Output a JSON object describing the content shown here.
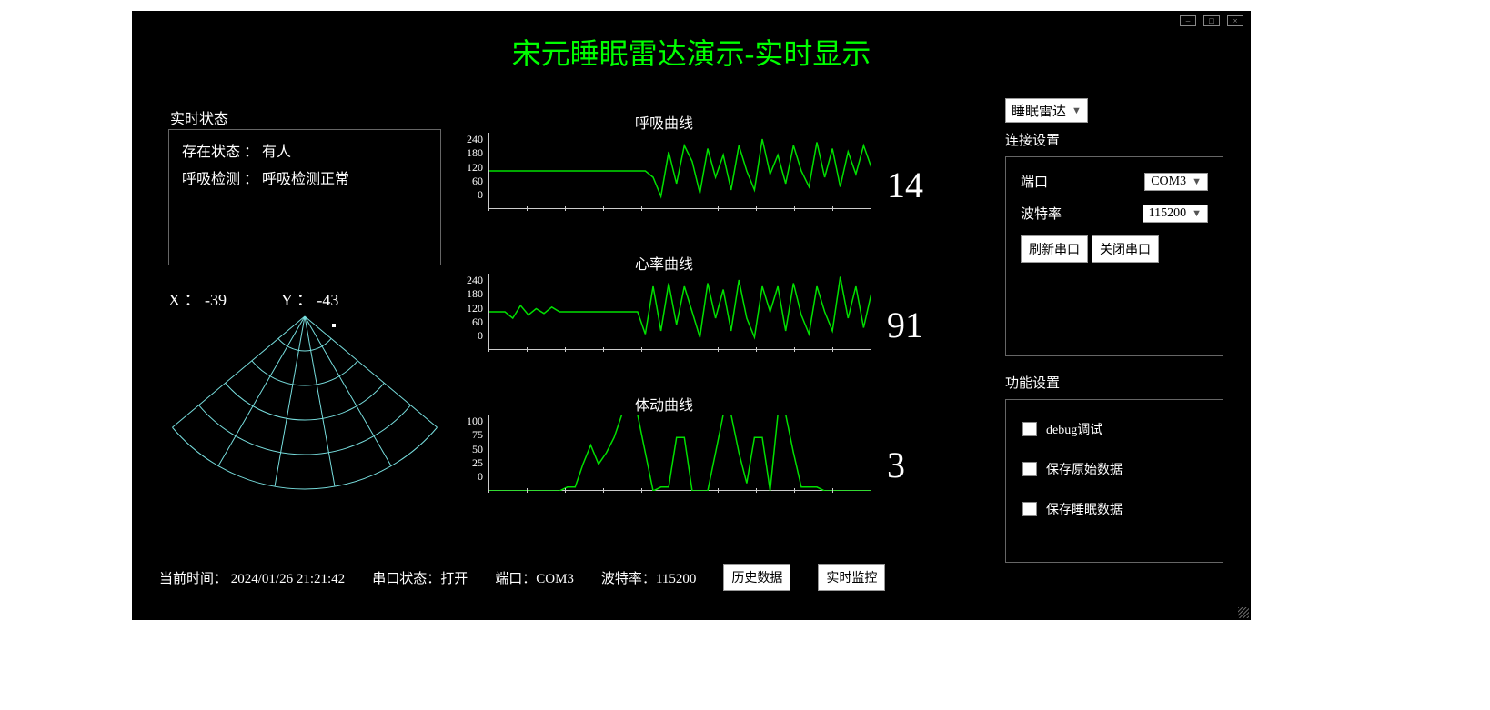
{
  "title": "宋元睡眠雷达演示-实时显示",
  "status_panel": {
    "label": "实时状态",
    "row1_label": "存在状态 ：",
    "row1_value": "有人",
    "row2_label": "呼吸检测 ：",
    "row2_value": "呼吸检测正常"
  },
  "xy": {
    "x_label": "X ：",
    "x_value": "-39",
    "y_label": "Y ：",
    "y_value": "-43"
  },
  "charts": {
    "breath": {
      "title": "呼吸曲线",
      "ymax": 240,
      "value": "14"
    },
    "heart": {
      "title": "心率曲线",
      "ymax": 240,
      "value": "91"
    },
    "motion": {
      "title": "体动曲线",
      "ymax": 100,
      "value": "3"
    }
  },
  "chart_data": [
    {
      "type": "line",
      "title": "呼吸曲线",
      "xlabel": "",
      "ylabel": "",
      "ylim": [
        0,
        240
      ],
      "yticks": [
        0,
        60,
        120,
        180,
        240
      ],
      "values": [
        120,
        120,
        120,
        120,
        120,
        120,
        120,
        120,
        120,
        120,
        120,
        120,
        120,
        120,
        120,
        120,
        120,
        120,
        120,
        120,
        120,
        100,
        40,
        180,
        80,
        200,
        150,
        50,
        190,
        100,
        170,
        60,
        200,
        120,
        60,
        220,
        110,
        170,
        80,
        200,
        120,
        70,
        210,
        100,
        190,
        70,
        180,
        110,
        200,
        130
      ]
    },
    {
      "type": "line",
      "title": "心率曲线",
      "xlabel": "",
      "ylabel": "",
      "ylim": [
        0,
        240
      ],
      "yticks": [
        0,
        60,
        120,
        180,
        240
      ],
      "values": [
        120,
        120,
        120,
        100,
        140,
        110,
        130,
        115,
        135,
        120,
        120,
        120,
        120,
        120,
        120,
        120,
        120,
        120,
        120,
        120,
        50,
        200,
        60,
        210,
        80,
        200,
        120,
        40,
        210,
        100,
        190,
        60,
        220,
        100,
        40,
        200,
        120,
        200,
        60,
        210,
        110,
        50,
        200,
        120,
        60,
        230,
        100,
        200,
        70,
        180
      ]
    },
    {
      "type": "line",
      "title": "体动曲线",
      "xlabel": "",
      "ylabel": "",
      "ylim": [
        0,
        100
      ],
      "yticks": [
        0,
        25,
        50,
        75,
        100
      ],
      "values": [
        0,
        0,
        0,
        0,
        0,
        0,
        0,
        0,
        0,
        0,
        5,
        5,
        35,
        60,
        35,
        50,
        70,
        100,
        100,
        100,
        50,
        0,
        5,
        5,
        70,
        70,
        0,
        0,
        0,
        50,
        100,
        100,
        50,
        10,
        70,
        70,
        0,
        100,
        100,
        50,
        5,
        5,
        5,
        0,
        0,
        0,
        0,
        0,
        0,
        0
      ]
    }
  ],
  "right": {
    "mode_select": "睡眠雷达",
    "connection_label": "连接设置",
    "port_label": "端口",
    "port_value": "COM3",
    "baud_label": "波特率",
    "baud_value": "115200",
    "refresh_btn": "刷新串口",
    "close_btn": "关闭串口",
    "functions_label": "功能设置",
    "cb1": "debug调试",
    "cb2": "保存原始数据",
    "cb3": "保存睡眠数据"
  },
  "statusbar": {
    "time_label": "当前时间：",
    "time_value": "2024/01/26 21:21:42",
    "port_status_label": "串口状态：",
    "port_status_value": "打开",
    "port_label": "端口：",
    "port_value": "COM3",
    "baud_label": "波特率：",
    "baud_value": "115200",
    "history_btn": "历史数据",
    "realtime_btn": "实时监控"
  },
  "yticks240": [
    "240",
    "180",
    "120",
    "60",
    "0"
  ],
  "yticks100": [
    "100",
    "75",
    "50",
    "25",
    "0"
  ]
}
